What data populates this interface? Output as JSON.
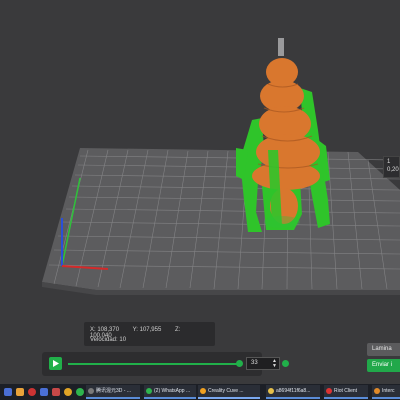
{
  "viewport": {
    "layer_readout": {
      "layer": "1",
      "height": "0,20"
    }
  },
  "coords": {
    "x_label": "X:",
    "x_value": "108,370",
    "y_label": "Y:",
    "y_value": "107,955",
    "z_label": "Z:",
    "z_value": "100,040",
    "speed_label": "Velocidad:",
    "speed_value": "10"
  },
  "player": {
    "layer_value": "33",
    "progress": 0.97
  },
  "actions": {
    "slice_label": "Lamina",
    "send_label": "Enviar i"
  },
  "taskbar": {
    "items": [
      {
        "label": "腾讯混元3D - ..."
      },
      {
        "label": "(2) WhatsApp ..."
      },
      {
        "label": "Creality Cuve ..."
      },
      {
        "label": "a8694f11f6a8..."
      },
      {
        "label": "Riot Client"
      },
      {
        "label": "Interc"
      }
    ]
  },
  "colors": {
    "accent": "#21b04a",
    "model_orange": "#d9772e",
    "support_green": "#2fc42a",
    "bed": "#5e5e60"
  }
}
